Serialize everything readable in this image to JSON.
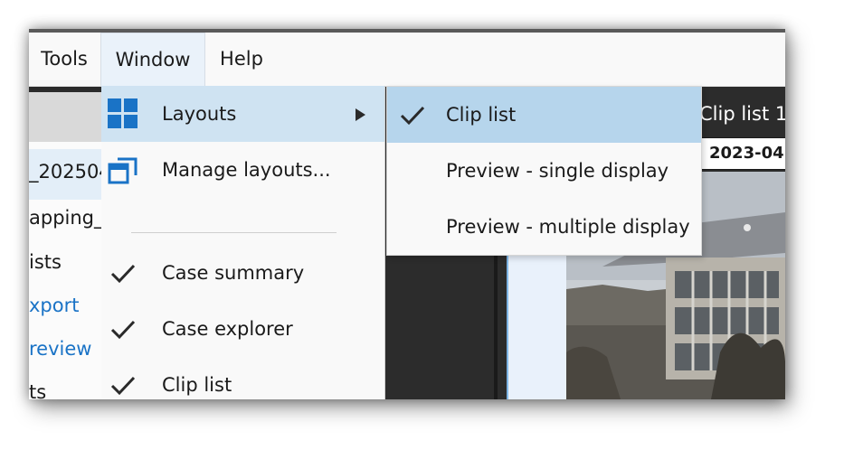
{
  "menubar": {
    "items": [
      {
        "label": "Tools"
      },
      {
        "label": "Window"
      },
      {
        "label": "Help"
      }
    ]
  },
  "left_panel": {
    "items": [
      {
        "label": "_202504"
      },
      {
        "label": "apping_"
      },
      {
        "label": "ists"
      },
      {
        "label": "xport"
      },
      {
        "label": "review"
      },
      {
        "label": "ts"
      }
    ]
  },
  "window_menu": {
    "items": [
      {
        "label": "Layouts",
        "icon": "layouts-grid-icon",
        "has_submenu": true,
        "highlighted": true
      },
      {
        "label": "Manage layouts...",
        "icon": "manage-layouts-icon"
      },
      {
        "label": "Case summary",
        "checked": true
      },
      {
        "label": "Case explorer",
        "checked": true
      },
      {
        "label": "Clip list",
        "checked": true
      }
    ]
  },
  "layouts_submenu": {
    "items": [
      {
        "label": "Clip list",
        "checked": true,
        "highlighted": true
      },
      {
        "label": "Preview - single display",
        "checked": false
      },
      {
        "label": "Preview - multiple display",
        "checked": false
      }
    ]
  },
  "right_panel": {
    "header_label": "Clip list  1",
    "date_value": "2023-04"
  },
  "colors": {
    "highlight_submenu": "#b6d5ec",
    "highlight_menu": "#cfe3f2",
    "icon_blue": "#1a73c6",
    "dark_panel": "#2c2c2c"
  }
}
